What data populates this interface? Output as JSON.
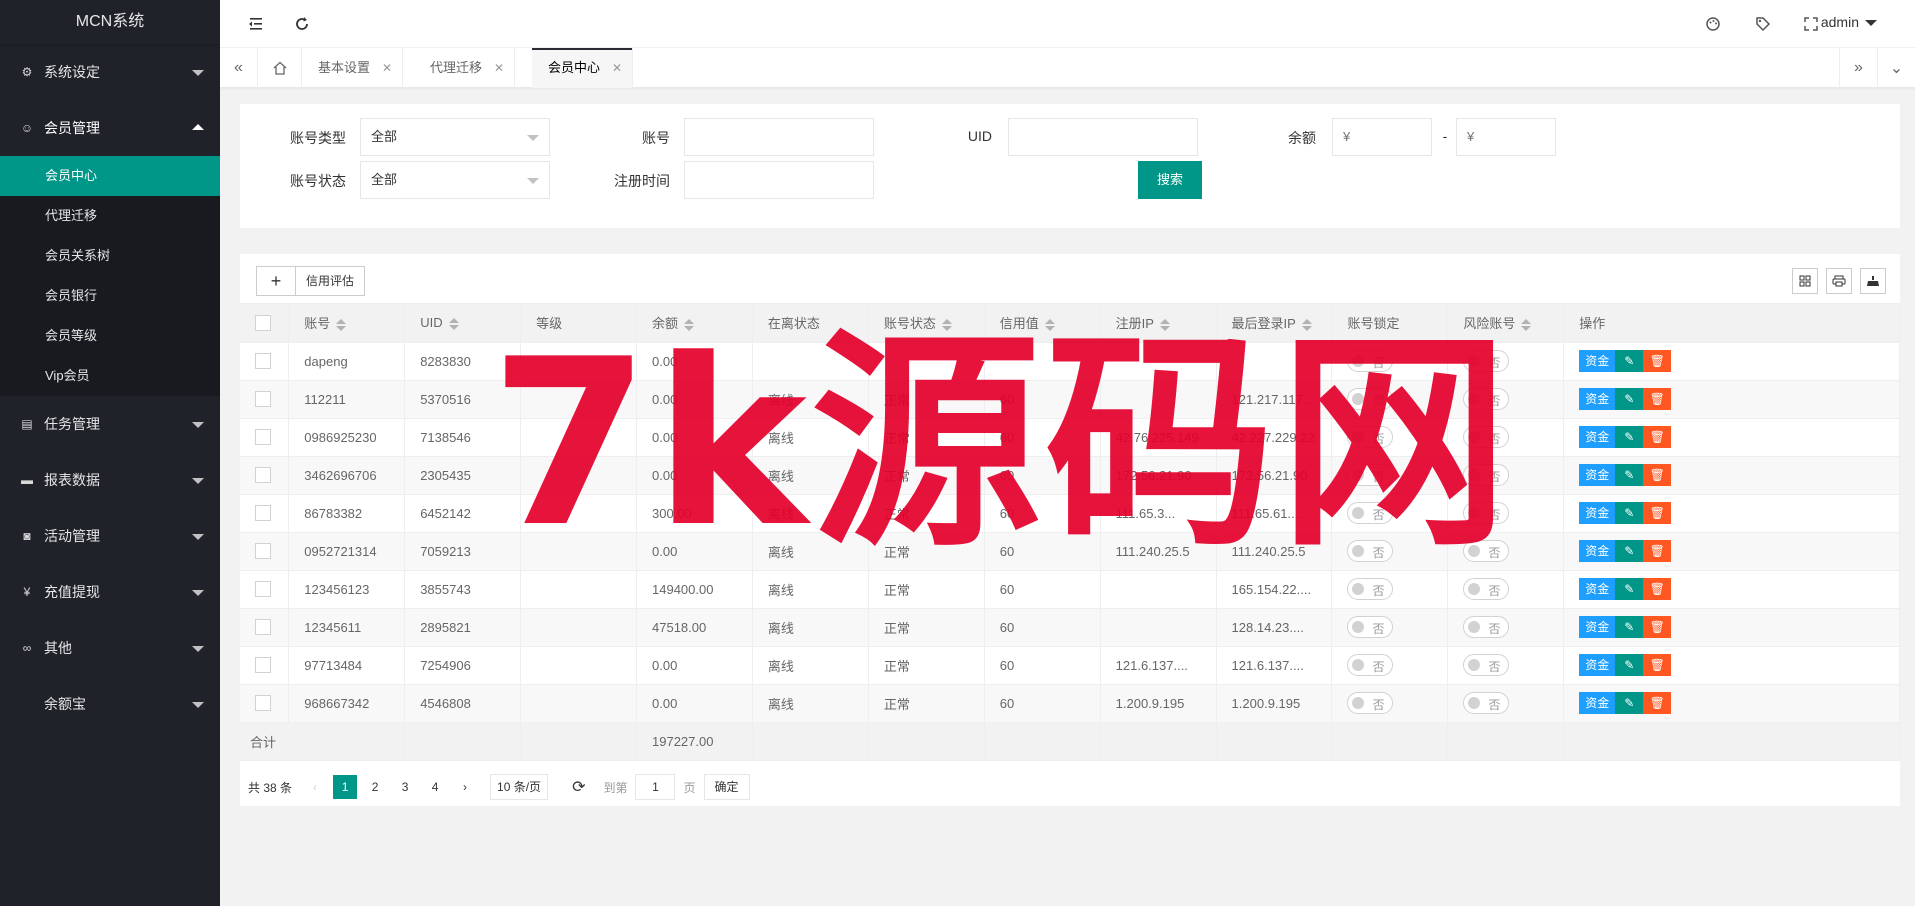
{
  "app": {
    "logo": "MCN系统"
  },
  "sidebar": {
    "groups": [
      {
        "label": "系统设定",
        "icon": "gear-icon"
      },
      {
        "label": "会员管理",
        "icon": "user-icon",
        "open": true,
        "items": [
          "会员中心",
          "代理迁移",
          "会员关系树",
          "会员银行",
          "会员等级",
          "Vip会员"
        ]
      },
      {
        "label": "任务管理",
        "icon": "file-icon"
      },
      {
        "label": "报表数据",
        "icon": "chart-icon"
      },
      {
        "label": "活动管理",
        "icon": "binocular-icon"
      },
      {
        "label": "充值提现",
        "icon": "yen-icon"
      },
      {
        "label": "其他",
        "icon": "link-icon"
      },
      {
        "label": "余额宝",
        "icon": ""
      }
    ],
    "active_item": "会员中心"
  },
  "header": {
    "user": "admin"
  },
  "tabs": [
    {
      "label": "基本设置"
    },
    {
      "label": "代理迁移"
    },
    {
      "label": "会员中心",
      "active": true
    }
  ],
  "search": {
    "account_type_label": "账号类型",
    "account_type_value": "全部",
    "account_label": "账号",
    "uid_label": "UID",
    "balance_label": "余额",
    "balance_min_ph": "¥",
    "balance_max_ph": "¥",
    "range_sep": "-",
    "account_status_label": "账号状态",
    "account_status_value": "全部",
    "reg_time_label": "注册时间",
    "search_button": "搜索"
  },
  "toolbar": {
    "add": "+",
    "credit": "信用评估"
  },
  "table": {
    "columns": [
      "账号",
      "UID",
      "等级",
      "余额",
      "在离状态",
      "账号状态",
      "信用值",
      "注册IP",
      "最后登录IP",
      "账号锁定",
      "风险账号",
      "操作"
    ],
    "switch_off": "否",
    "ops": {
      "fund": "资金"
    },
    "rows": [
      {
        "account": "dapeng",
        "uid": "8283830",
        "level": "",
        "balance": "0.00",
        "online": "",
        "status": "",
        "credit": "",
        "reg_ip": "",
        "last_ip": ""
      },
      {
        "account": "112211",
        "uid": "5370516",
        "level": "",
        "balance": "0.00",
        "online": "离线",
        "status": "正常",
        "credit": "60",
        "reg_ip": "",
        "last_ip": "121.217.117..."
      },
      {
        "account": "0986925230",
        "uid": "7138546",
        "level": "",
        "balance": "0.00",
        "online": "离线",
        "status": "正常",
        "credit": "60",
        "reg_ip": "42.76.225.149",
        "last_ip": "42.227.229.22"
      },
      {
        "account": "3462696706",
        "uid": "2305435",
        "level": "",
        "balance": "0.00",
        "online": "离线",
        "status": "正常",
        "credit": "60",
        "reg_ip": "172.56.21.90",
        "last_ip": "172.56.21.90"
      },
      {
        "account": "86783382",
        "uid": "6452142",
        "level": "",
        "balance": "300.00",
        "online": "离线",
        "status": "正常",
        "credit": "60",
        "reg_ip": "111.65.3...",
        "last_ip": "111.65.61...."
      },
      {
        "account": "0952721314",
        "uid": "7059213",
        "level": "",
        "balance": "0.00",
        "online": "离线",
        "status": "正常",
        "credit": "60",
        "reg_ip": "111.240.25.5",
        "last_ip": "111.240.25.5"
      },
      {
        "account": "123456123",
        "uid": "3855743",
        "level": "",
        "balance": "149400.00",
        "online": "离线",
        "status": "正常",
        "credit": "60",
        "reg_ip": "",
        "last_ip": "165.154.22...."
      },
      {
        "account": "12345611",
        "uid": "2895821",
        "level": "",
        "balance": "47518.00",
        "online": "离线",
        "status": "正常",
        "credit": "60",
        "reg_ip": "",
        "last_ip": "128.14.23...."
      },
      {
        "account": "97713484",
        "uid": "7254906",
        "level": "",
        "balance": "0.00",
        "online": "离线",
        "status": "正常",
        "credit": "60",
        "reg_ip": "121.6.137....",
        "last_ip": "121.6.137...."
      },
      {
        "account": "968667342",
        "uid": "4546808",
        "level": "",
        "balance": "0.00",
        "online": "离线",
        "status": "正常",
        "credit": "60",
        "reg_ip": "1.200.9.195",
        "last_ip": "1.200.9.195"
      }
    ],
    "total_label": "合计",
    "total_balance": "197227.00"
  },
  "pager": {
    "total": "共 38 条",
    "pages": [
      "1",
      "2",
      "3",
      "4"
    ],
    "current": "1",
    "limit": "10 条/页",
    "goto_label": "到第",
    "goto_value": "1",
    "page_unit": "页",
    "confirm": "确定"
  },
  "watermark": "7k源码网"
}
